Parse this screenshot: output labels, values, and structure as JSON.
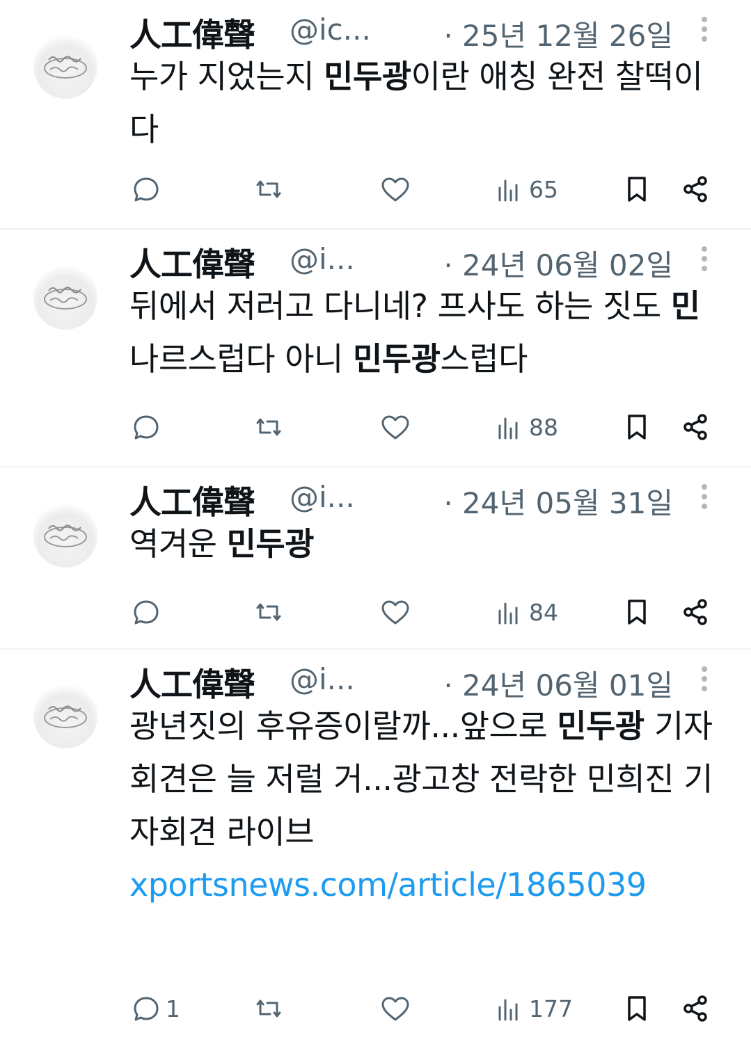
{
  "tweets": [
    {
      "name": "人工偉聲",
      "handle": "@ic...",
      "date": "· 25년 12월 26일",
      "text": [
        {
          "t": "누가 지었는지 "
        },
        {
          "t": "민두광",
          "b": true
        },
        {
          "t": "이란 애칭 완전 찰떡이다"
        }
      ],
      "replies": "",
      "views": "65"
    },
    {
      "name": "人工偉聲",
      "handle": "@i...",
      "date": "· 24년 06월 02일",
      "text": [
        {
          "t": "뒤에서 저러고 다니네? 프사도 하는 짓도 "
        },
        {
          "t": "민",
          "b": true
        },
        {
          "t": "나르스럽다 아니 "
        },
        {
          "t": "민두광",
          "b": true
        },
        {
          "t": "스럽다"
        }
      ],
      "replies": "",
      "views": "88"
    },
    {
      "name": "人工偉聲",
      "handle": "@i...",
      "date": "· 24년 05월 31일",
      "text": [
        {
          "t": "역겨운 "
        },
        {
          "t": "민두광",
          "b": true
        }
      ],
      "replies": "",
      "views": "84"
    },
    {
      "name": "人工偉聲",
      "handle": "@i...",
      "date": "· 24년 06월 01일",
      "text": [
        {
          "t": "광년짓의 후유증이랄까...앞으로 "
        },
        {
          "t": "민두광",
          "b": true
        },
        {
          "t": " 기자회견은 늘 저럴 거...광고창 전락한 민희진 기자회견 라이브"
        },
        {
          "t": "xportsnews.com/article/1865039",
          "link": true
        }
      ],
      "replies": "1",
      "views": "177"
    }
  ],
  "colors": {
    "text": "#0f1419",
    "muted": "#536471",
    "link": "#1d9bf0",
    "divider": "#eff3f4"
  },
  "icons": [
    "reply-icon",
    "retweet-icon",
    "like-icon",
    "views-icon",
    "bookmark-icon",
    "share-icon",
    "more-icon"
  ]
}
